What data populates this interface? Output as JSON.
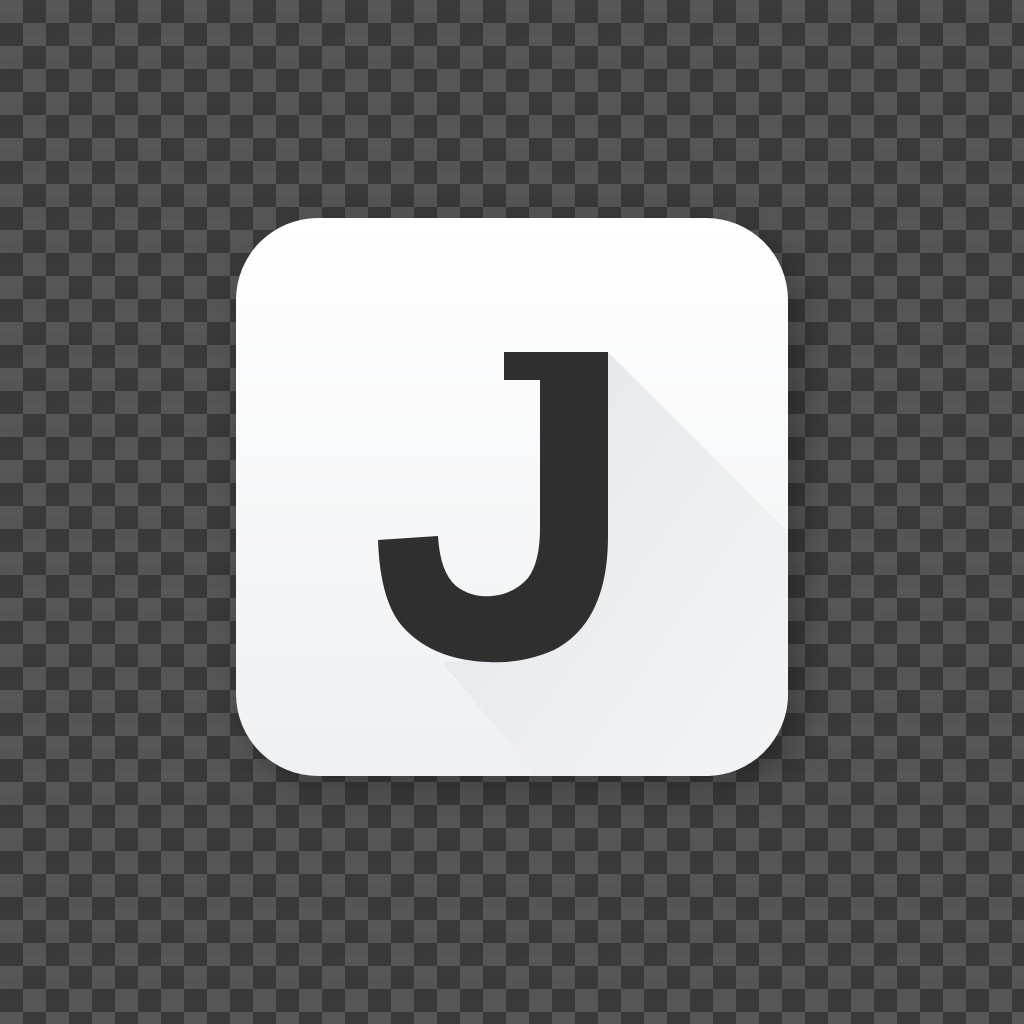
{
  "app_icon": {
    "glyph": "J",
    "tile_color": "#ffffff",
    "glyph_color": "#2f2f2f",
    "long_shadow_color": "#e3e6e9",
    "background_pattern": "checkerboard"
  }
}
